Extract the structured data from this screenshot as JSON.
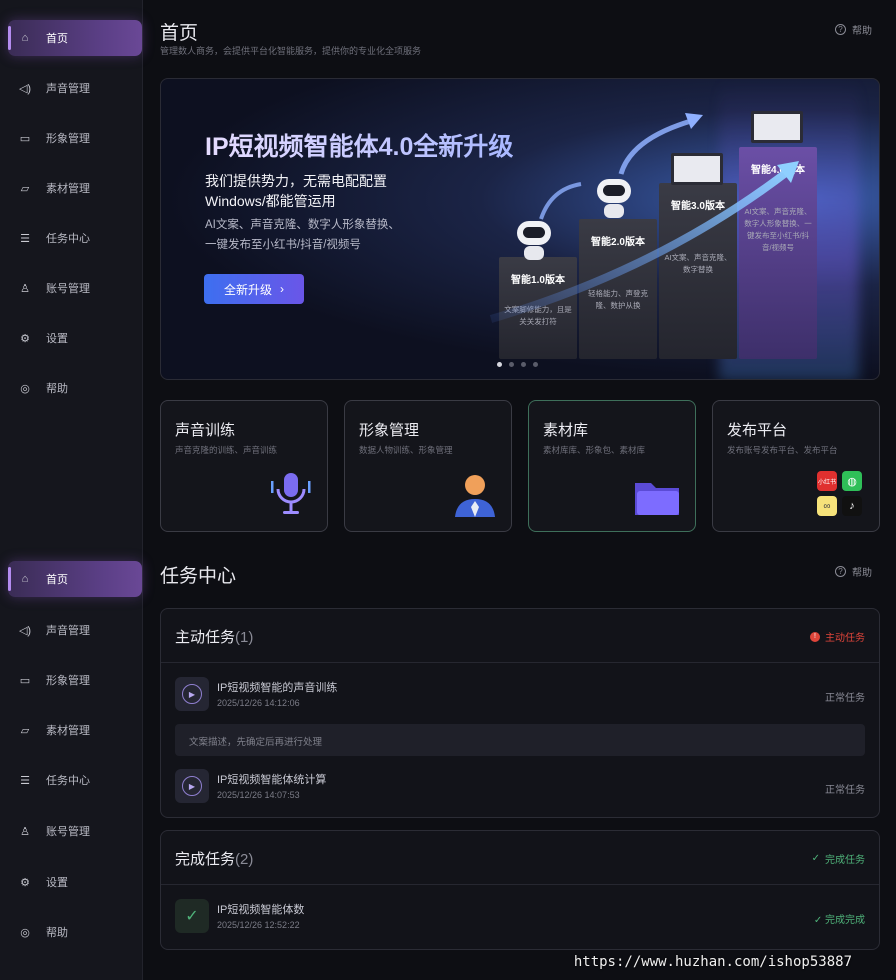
{
  "sidebar": {
    "items": [
      {
        "label": "首页",
        "icon": "home-icon"
      },
      {
        "label": "声音管理",
        "icon": "speaker-icon"
      },
      {
        "label": "形象管理",
        "icon": "video-icon"
      },
      {
        "label": "素材管理",
        "icon": "folder-icon"
      },
      {
        "label": "任务中心",
        "icon": "list-icon"
      },
      {
        "label": "账号管理",
        "icon": "user-icon"
      },
      {
        "label": "设置",
        "icon": "settings-icon"
      },
      {
        "label": "帮助",
        "icon": "help-icon"
      }
    ]
  },
  "home": {
    "title": "首页",
    "subtitle": "管理数人商务，会提供平台化智能服务，提供你的专业化全项服务",
    "help": "帮助"
  },
  "banner": {
    "headline": "IP短视频智能体4.0全新升级",
    "line1": "我们提供势力，无需电配配置",
    "line2": "Windows/都能管运用",
    "line3": "AI文案、声音克隆、数字人形象替换、",
    "line4": "一键发布至小红书/抖音/视频号",
    "button": "全新升级",
    "steps": [
      {
        "title": "智能1.0版本",
        "desc": "文案脚修能力，且是关关发打符"
      },
      {
        "title": "智能2.0版本",
        "desc": "轻格能力、声登克隆、数护从换"
      },
      {
        "title": "智能3.0版本",
        "desc": "AI文案、声音克隆、数字替换"
      },
      {
        "title": "智能4.0版本",
        "desc": "AI文案、声音克隆、数字人形象替换、一键发布至小红书/抖音/视频号"
      }
    ]
  },
  "features": [
    {
      "title": "声音训练",
      "sub": "声音克隆的训练、声音训练",
      "icon": "microphone-icon"
    },
    {
      "title": "形象管理",
      "sub": "数据人物训练、形象管理",
      "icon": "person-icon"
    },
    {
      "title": "素材库",
      "sub": "素材库库、形象包、素材库",
      "icon": "folder-icon"
    },
    {
      "title": "发布平台",
      "sub": "发布账号发布平台、发布平台",
      "icon": "platforms-icon"
    }
  ],
  "tasks": {
    "title": "任务中心",
    "help": "帮助",
    "active": {
      "title": "主动任务",
      "count": "(1)",
      "tag": "主动任务",
      "items": [
        {
          "name": "IP短视频智能的声音训练",
          "time": "2025/12/26 14:12:06",
          "status": "正常任务"
        },
        {
          "name": "IP短视频智能体统计算",
          "time": "2025/12/26 14:07:53",
          "status": "正常任务"
        }
      ],
      "notice": "文案描述，先确定后再进行处理"
    },
    "done": {
      "title": "完成任务",
      "count": "(2)",
      "tag": "完成任务",
      "items": [
        {
          "name": "IP短视频智能体数",
          "time": "2025/12/26 12:52:22",
          "status": "完成完成"
        }
      ]
    }
  },
  "watermark": "https://www.huzhan.com/ishop53887",
  "colors": {
    "accent": "#6a4896",
    "primary_button": "#3d6ff0",
    "danger": "#e0453a",
    "success": "#4fb37a"
  }
}
